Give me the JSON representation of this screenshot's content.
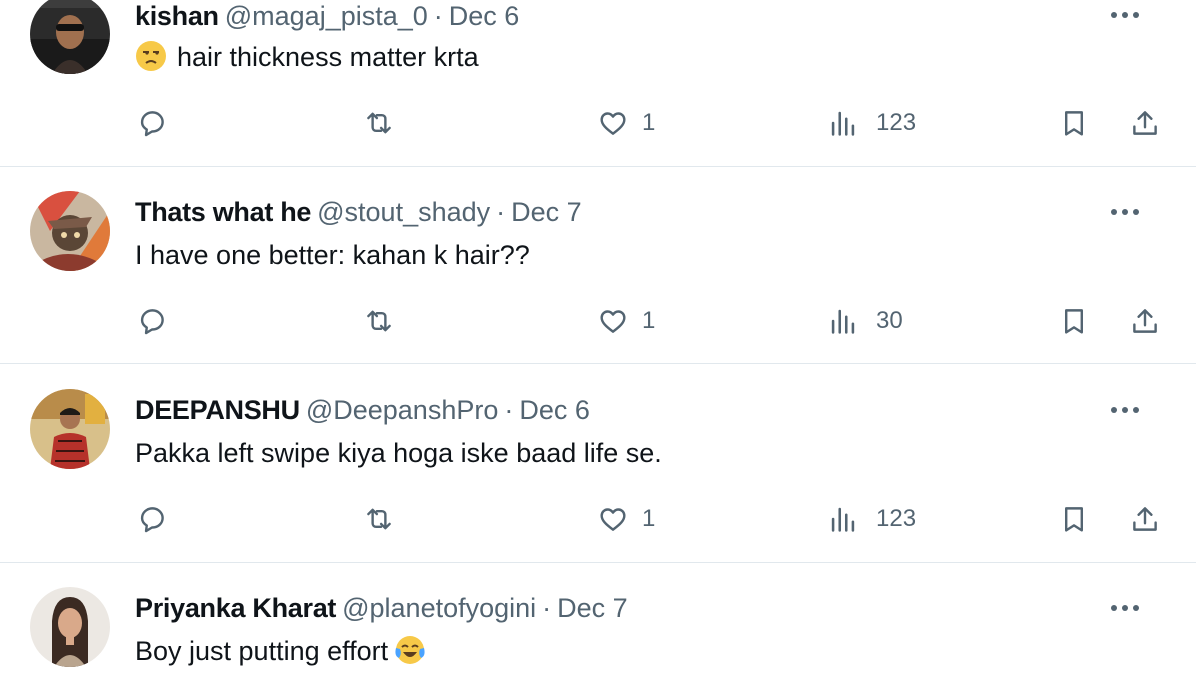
{
  "colors": {
    "text": "#0f1419",
    "muted": "#536471",
    "divider": "#e1e8ed"
  },
  "icons": {
    "reply": "speech-bubble-icon",
    "retweet": "retweet-arrows-icon",
    "like": "heart-icon",
    "views": "bar-chart-icon",
    "bookmark": "bookmark-icon",
    "share": "share-upload-icon",
    "more": "more-dots-icon"
  },
  "tweets": [
    {
      "name": "kishan",
      "handle": "@magaj_pista_0",
      "separator": "·",
      "date": "Dec 6",
      "text": "hair thickness matter krta",
      "lead_emoji": "😒",
      "likes": "1",
      "views": "123"
    },
    {
      "name": "Thats what he",
      "handle": "@stout_shady",
      "separator": "·",
      "date": "Dec 7",
      "text": "I have one better: kahan k hair??",
      "likes": "1",
      "views": "30"
    },
    {
      "name": "DEEPANSHU",
      "handle": "@DeepanshPro",
      "separator": "·",
      "date": "Dec 6",
      "text": "Pakka left swipe kiya hoga iske baad life se.",
      "likes": "1",
      "views": "123"
    },
    {
      "name": "Priyanka Kharat",
      "handle": "@planetofyogini",
      "separator": "·",
      "date": "Dec 7",
      "text": "Boy just putting effort",
      "trail_emoji": "😂"
    }
  ]
}
